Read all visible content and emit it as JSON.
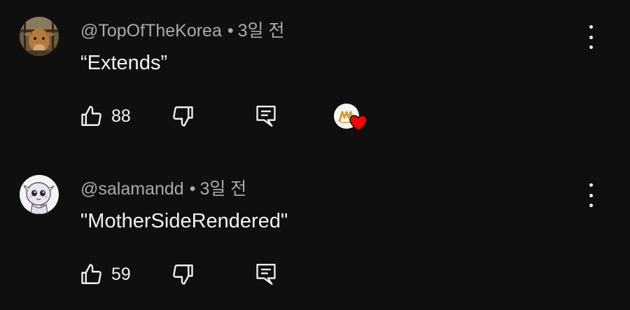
{
  "comments": [
    {
      "handle": "@TopOfTheKorea",
      "separator": "•",
      "time": "3일 전",
      "text": "“Extends”",
      "likes": "88",
      "avatar_icon": "cow-photo-avatar",
      "creator_hearted": true
    },
    {
      "handle": "@salamandd",
      "separator": "•",
      "time": "3일 전",
      "text": "\"MotherSideRendered\"",
      "likes": "59",
      "avatar_icon": "cartoon-character-avatar",
      "creator_hearted": false
    }
  ],
  "colors": {
    "background": "#0f0f0f",
    "text_primary": "#f1f1f1",
    "text_secondary": "#aaaaaa",
    "heart": "#ff0000",
    "creator_logo": "#d4a12a"
  }
}
